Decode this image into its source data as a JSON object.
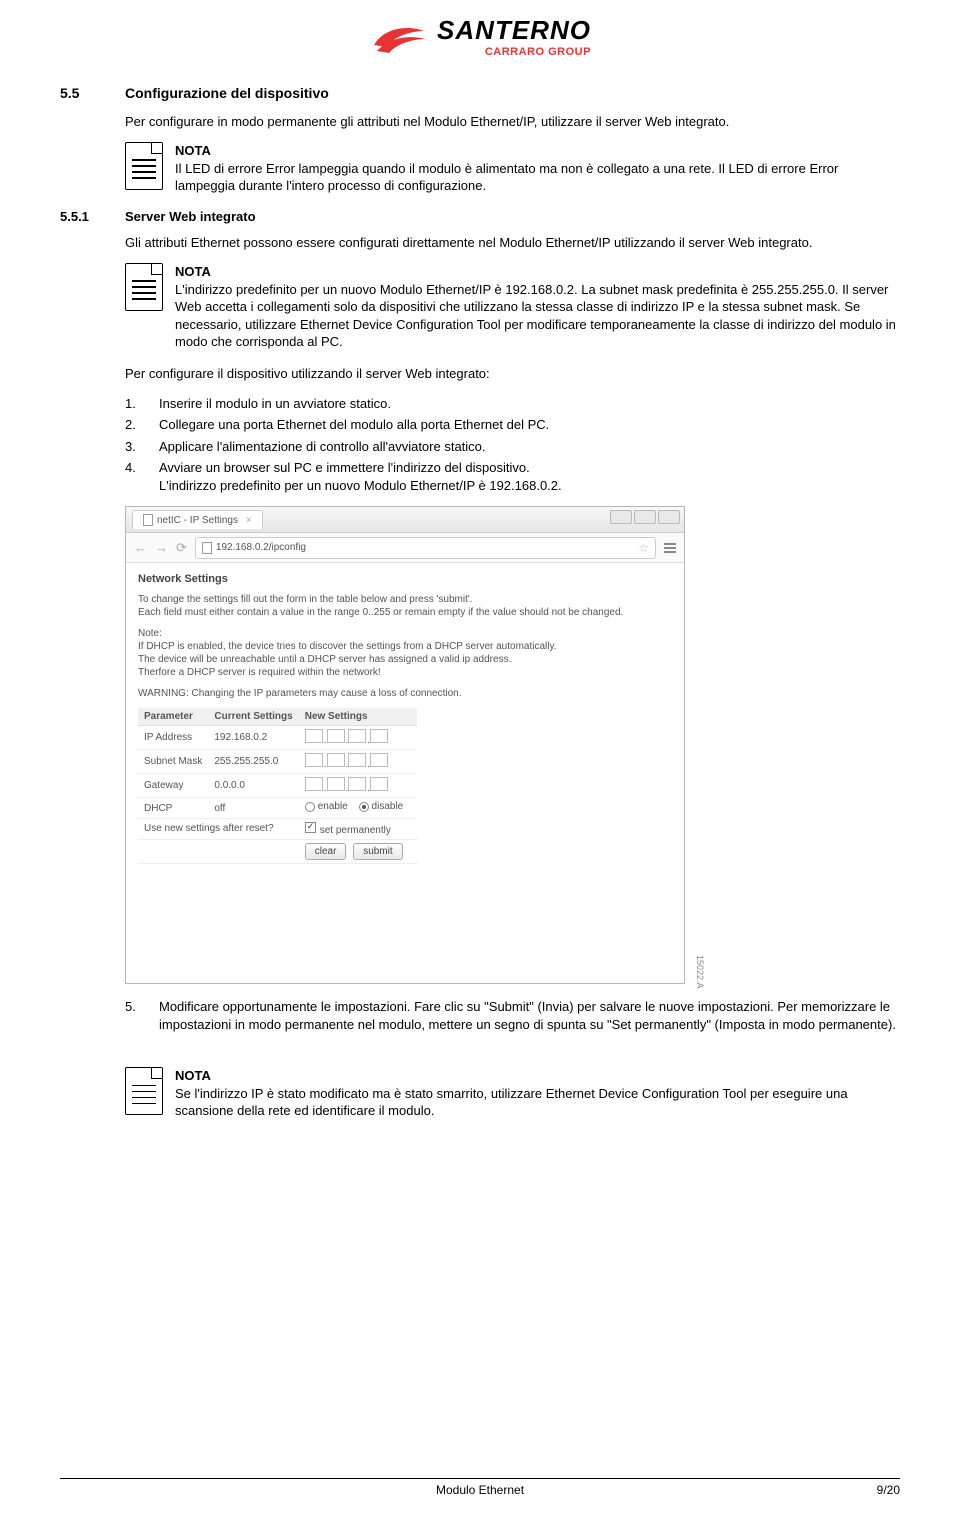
{
  "logo": {
    "main": "SANTERNO",
    "sub": "CARRARO GROUP"
  },
  "section55": {
    "num": "5.5",
    "title": "Configurazione del dispositivo",
    "intro": "Per configurare in modo permanente gli attributi nel Modulo Ethernet/IP, utilizzare il server Web integrato."
  },
  "note1": {
    "label": "NOTA",
    "text": "Il LED di errore Error lampeggia quando il modulo è alimentato ma non è collegato a una rete.   Il LED di errore Error lampeggia durante l'intero processo di configurazione."
  },
  "section551": {
    "num": "5.5.1",
    "title": "Server Web integrato",
    "intro": "Gli attributi Ethernet possono essere configurati direttamente nel Modulo Ethernet/IP utilizzando il server Web integrato."
  },
  "note2": {
    "label": "NOTA",
    "text": "L'indirizzo predefinito per un nuovo Modulo Ethernet/IP è 192.168.0.2.   La subnet mask predefinita è 255.255.255.0.   Il server Web accetta i collegamenti solo da dispositivi che utilizzano la stessa classe di indirizzo IP e la stessa subnet mask. Se necessario, utilizzare Ethernet Device Configuration Tool per modificare temporaneamente la classe di indirizzo del modulo in modo che corrisponda al PC."
  },
  "procedure_intro": "Per configurare il dispositivo utilizzando il server Web integrato:",
  "steps": [
    {
      "n": "1.",
      "t": "Inserire il modulo in un avviatore statico."
    },
    {
      "n": "2.",
      "t": "Collegare una porta Ethernet del modulo alla porta Ethernet del PC."
    },
    {
      "n": "3.",
      "t": "Applicare l'alimentazione di controllo all'avviatore statico."
    },
    {
      "n": "4.",
      "t": "Avviare un browser sul PC e immettere l'indirizzo del dispositivo.\nL'indirizzo predefinito per un nuovo Modulo Ethernet/IP è 192.168.0.2."
    }
  ],
  "browser": {
    "tab": "netIC - IP Settings",
    "url": "192.168.0.2/ipconfig",
    "heading": "Network Settings",
    "p1": "To change the settings fill out the form in the table below and press 'submit'.\nEach field must either contain a value in the range 0..255 or remain empty if the value should not be changed.",
    "note_label": "Note:",
    "note_text": "If DHCP is enabled, the device tries to discover the settings from a DHCP server automatically.\nThe device will be unreachable until a DHCP server has assigned a valid ip address.\nTherfore a DHCP server is required within the network!",
    "warn": "WARNING: Changing the IP parameters may cause a loss of connection.",
    "th": [
      "Parameter",
      "Current Settings",
      "New Settings"
    ],
    "rows": [
      {
        "p": "IP Address",
        "c": "192.168.0.2"
      },
      {
        "p": "Subnet Mask",
        "c": "255.255.255.0"
      },
      {
        "p": "Gateway",
        "c": "0.0.0.0"
      }
    ],
    "dhcp_label": "DHCP",
    "dhcp_value": "off",
    "radio_enable": "enable",
    "radio_disable": "disable",
    "reset_label": "Use new settings after reset?",
    "reset_check": "set permanently",
    "btn_clear": "clear",
    "btn_submit": "submit",
    "sidecode": "15022.A"
  },
  "step5": {
    "n": "5.",
    "t": "Modificare opportunamente le impostazioni.   Fare clic su \"Submit\" (Invia) per salvare le nuove impostazioni.   Per memorizzare le impostazioni in modo permanente nel modulo, mettere un segno di spunta su \"Set permanently\" (Imposta in modo permanente)."
  },
  "note3": {
    "label": "NOTA",
    "text": "Se l'indirizzo IP è stato modificato ma è stato smarrito, utilizzare Ethernet Device Configuration Tool per eseguire una scansione della rete ed identificare il modulo."
  },
  "footer": {
    "center": "Modulo Ethernet",
    "right": "9/20"
  }
}
